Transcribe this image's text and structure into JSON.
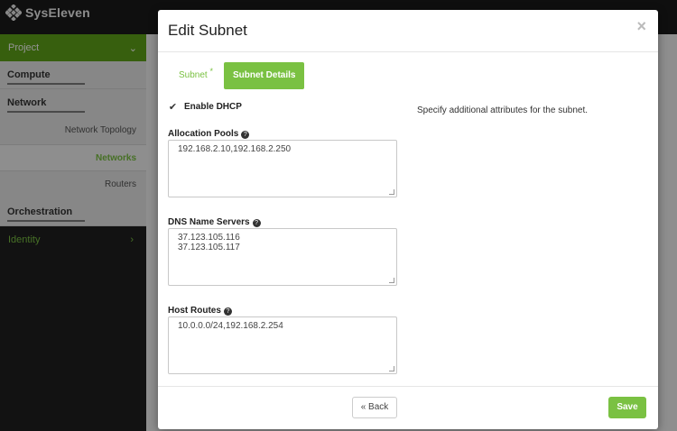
{
  "app": {
    "brand": "SysEleven"
  },
  "sidebar": {
    "project_label": "Project",
    "sections": [
      {
        "label": "Compute"
      },
      {
        "label": "Network"
      }
    ],
    "network_items": [
      {
        "label": "Network Topology"
      },
      {
        "label": "Networks"
      },
      {
        "label": "Routers"
      }
    ],
    "orchestration_label": "Orchestration",
    "identity_label": "Identity"
  },
  "modal": {
    "title": "Edit Subnet",
    "close_glyph": "×",
    "tabs": [
      {
        "label": "Subnet",
        "required_mark": "*"
      },
      {
        "label": "Subnet Details"
      }
    ],
    "enable_dhcp": {
      "label": "Enable DHCP",
      "checked": true,
      "glyph": "✔"
    },
    "help_glyph": "?",
    "allocation_pools": {
      "label": "Allocation Pools",
      "value": "192.168.2.10,192.168.2.250"
    },
    "dns_name_servers": {
      "label": "DNS Name Servers",
      "lines": [
        "37.123.105.116",
        "37.123.105.117"
      ]
    },
    "host_routes": {
      "label": "Host Routes",
      "value": "10.0.0.0/24,192.168.2.254"
    },
    "help_text": "Specify additional attributes for the subnet.",
    "back_label": "« Back",
    "save_label": "Save"
  },
  "colors": {
    "accent": "#7ac142",
    "project_bar": "#5fa419"
  }
}
